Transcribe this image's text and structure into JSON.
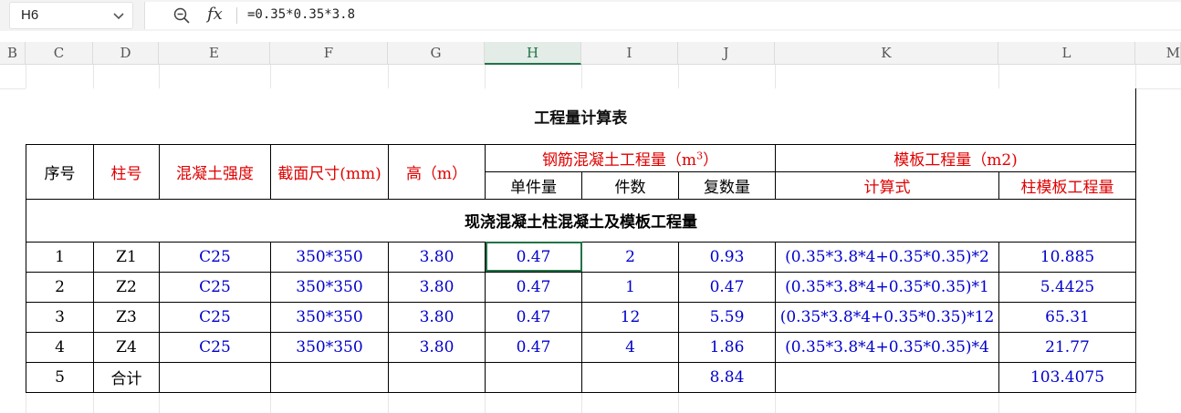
{
  "formula_bar": {
    "cell_ref": "H6",
    "formula": "=0.35*0.35*3.8"
  },
  "columns": [
    "B",
    "C",
    "D",
    "E",
    "F",
    "G",
    "H",
    "I",
    "J",
    "K",
    "L",
    "M"
  ],
  "selected_column": "H",
  "sheet": {
    "title": "工程量计算表",
    "headers": {
      "seq": "序号",
      "col_no": "柱号",
      "strength": "混凝土强度",
      "section": "截面尺寸(mm)",
      "height": "高（m）",
      "rc_group": "钢筋混凝土工程量（m",
      "rc_sup": "3",
      "rc_close": "）",
      "form_group": "模板工程量（m2)",
      "unit_qty": "单件量",
      "count": "件数",
      "total_qty": "复数量",
      "formula": "计算式",
      "col_form_qty": "柱模板工程量"
    },
    "section_title": "现浇混凝土柱混凝土及模板工程量",
    "rows": [
      {
        "seq": "1",
        "col": "Z1",
        "strength": "C25",
        "size": "350*350",
        "h": "3.80",
        "unit": "0.47",
        "count": "2",
        "total": "0.93",
        "formula": "(0.35*3.8*4+0.35*0.35)*2",
        "form": "10.885"
      },
      {
        "seq": "2",
        "col": "Z2",
        "strength": "C25",
        "size": "350*350",
        "h": "3.80",
        "unit": "0.47",
        "count": "1",
        "total": "0.47",
        "formula": "(0.35*3.8*4+0.35*0.35)*1",
        "form": "5.4425"
      },
      {
        "seq": "3",
        "col": "Z3",
        "strength": "C25",
        "size": "350*350",
        "h": "3.80",
        "unit": "0.47",
        "count": "12",
        "total": "5.59",
        "formula": "(0.35*3.8*4+0.35*0.35)*12",
        "form": "65.31"
      },
      {
        "seq": "4",
        "col": "Z4",
        "strength": "C25",
        "size": "350*350",
        "h": "3.80",
        "unit": "0.47",
        "count": "4",
        "total": "1.86",
        "formula": "(0.35*3.8*4+0.35*0.35)*4",
        "form": "21.77"
      }
    ],
    "total_row": {
      "seq": "5",
      "label": "合计",
      "total": "8.84",
      "form": "103.4075"
    }
  },
  "colors": {
    "accent": "#217346",
    "red_text": "#e00000",
    "blue_text": "#0000cc"
  }
}
